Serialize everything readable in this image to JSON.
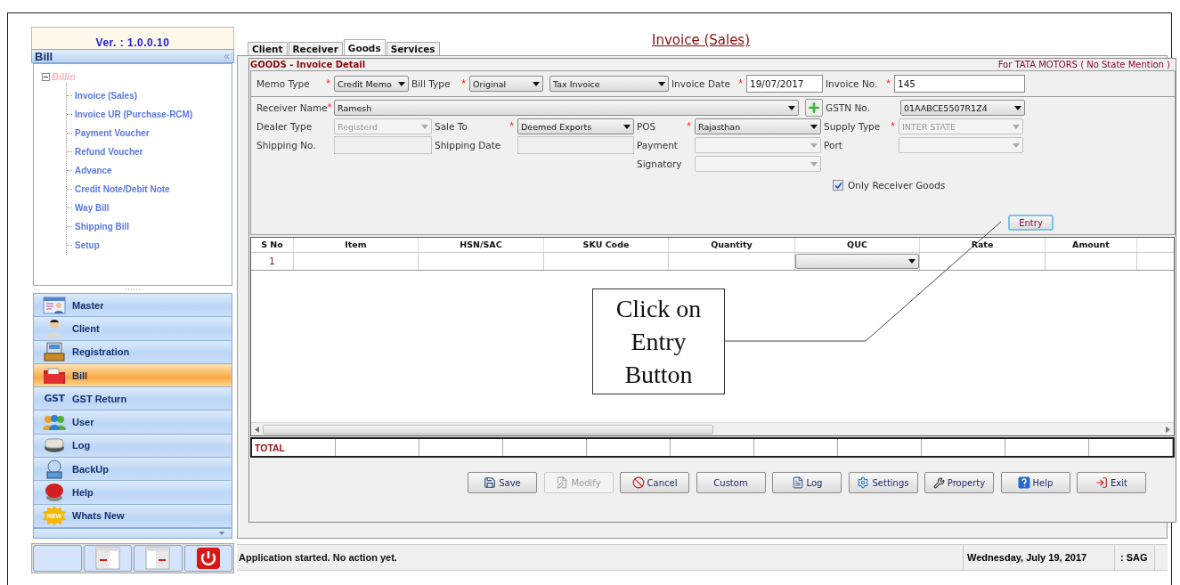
{
  "sidebar": {
    "version": "Ver. : 1.0.0.10",
    "title": "Bill",
    "collapse_glyph": "«",
    "tree": {
      "label": "Billin",
      "expanded": true,
      "children": [
        {
          "label": "Invoice (Sales)"
        },
        {
          "label": "Invoice UR (Purchase-RCM)"
        },
        {
          "label": "Payment Voucher"
        },
        {
          "label": "Refund Voucher"
        },
        {
          "label": "Advance"
        },
        {
          "label": "Credit Note/Debit Note"
        },
        {
          "label": "Way Bill"
        },
        {
          "label": "Shipping Bill"
        },
        {
          "label": "Setup"
        }
      ]
    },
    "nav": [
      {
        "label": "Master",
        "selected": false
      },
      {
        "label": "Client",
        "selected": false
      },
      {
        "label": "Registration",
        "selected": false
      },
      {
        "label": "Bill",
        "selected": true
      },
      {
        "label": "GST Return",
        "selected": false,
        "logo_text": "GST"
      },
      {
        "label": "User",
        "selected": false
      },
      {
        "label": "Log",
        "selected": false
      },
      {
        "label": "BackUp",
        "selected": false
      },
      {
        "label": "Help",
        "selected": false
      },
      {
        "label": "Whats New",
        "selected": false,
        "logo_text": "NEW"
      }
    ],
    "toolbar": [
      {
        "kind": "blank"
      },
      {
        "kind": "left_pane"
      },
      {
        "kind": "right_pane"
      },
      {
        "kind": "power"
      }
    ]
  },
  "tabs": [
    {
      "label": "Client",
      "selected": false
    },
    {
      "label": "Receiver",
      "selected": false
    },
    {
      "label": "Goods",
      "selected": true
    },
    {
      "label": "Services",
      "selected": false
    }
  ],
  "page_title": "Invoice (Sales)",
  "form": {
    "section_title": "GOODS - Invoice Detail",
    "note": "For TATA MOTORS ( No State Mention )",
    "header_row": [
      {
        "label": "Memo Type",
        "required_mark": "*",
        "kind": "combo",
        "value": "Credit Memo",
        "disabled": false
      },
      {
        "label": "Bill Type",
        "required_mark": "*",
        "kind": "combo",
        "value": "Original",
        "disabled": false
      },
      {
        "kind": "combo",
        "value": "Tax Invoice",
        "disabled": false
      },
      {
        "label": "Invoice Date",
        "required_mark": "*",
        "kind": "input",
        "value": "19/07/2017",
        "disabled": false
      },
      {
        "label": "Invoice No.",
        "required_mark": "*",
        "kind": "input",
        "value": "145",
        "disabled": false
      }
    ],
    "detail_rows": [
      [
        {
          "label": "Receiver Name",
          "required_mark": "*",
          "kind": "combo",
          "value": "Ramesh",
          "disabled": false
        },
        {
          "kind": "add"
        },
        {
          "label": "GSTN No.",
          "kind": "combo",
          "value": "01AABCE5507R1Z4",
          "disabled": false
        }
      ],
      [
        {
          "label": "Dealer Type",
          "kind": "combo",
          "value": "Registerd",
          "disabled": true
        },
        {
          "label": "Sale To",
          "required_mark": "*",
          "kind": "combo",
          "value": "Deemed Exports",
          "disabled": false
        },
        {
          "label": "POS",
          "required_mark": "*",
          "kind": "combo",
          "value": "Rajasthan",
          "disabled": false
        },
        {
          "label": "Supply Type",
          "required_mark": "*",
          "kind": "combo",
          "value": "INTER STATE",
          "disabled": true
        }
      ],
      [
        {
          "label": "Shipping No.",
          "kind": "input",
          "disabled": true
        },
        {
          "label": "Shipping Date",
          "kind": "input",
          "disabled": true
        },
        {
          "label": "Payment",
          "kind": "combo",
          "disabled": true
        },
        {
          "label": "Port",
          "kind": "combo",
          "disabled": true
        }
      ],
      [
        {
          "label": "Signatory",
          "kind": "combo",
          "disabled": true
        }
      ]
    ],
    "checkbox": {
      "label": "Only Receiver Goods",
      "checked": true
    },
    "entry_button": "Entry"
  },
  "table": {
    "columns": [
      "S No",
      "Item",
      "HSN/SAC",
      "SKU Code",
      "Quantity",
      "QUC",
      "Rate",
      "Amount"
    ],
    "rows": [
      {
        "s_no": "1"
      }
    ]
  },
  "totals": {
    "label": "TOTAL"
  },
  "actions": [
    {
      "label": "Save",
      "disabled": false
    },
    {
      "label": "Modify",
      "disabled": true
    },
    {
      "label": "Cancel",
      "disabled": false
    },
    {
      "label": "Custom",
      "disabled": false
    },
    {
      "label": "Log",
      "disabled": false
    },
    {
      "label": "Settings",
      "disabled": false
    },
    {
      "label": "Property",
      "disabled": false
    },
    {
      "label": "Help",
      "disabled": false
    },
    {
      "label": "Exit",
      "disabled": false
    }
  ],
  "callout": {
    "text": "Click on Entry Button"
  },
  "status_bar": {
    "message": "Application started. No action yet.",
    "date": "Wednesday, July 19, 2017",
    "user": ": SAG"
  }
}
